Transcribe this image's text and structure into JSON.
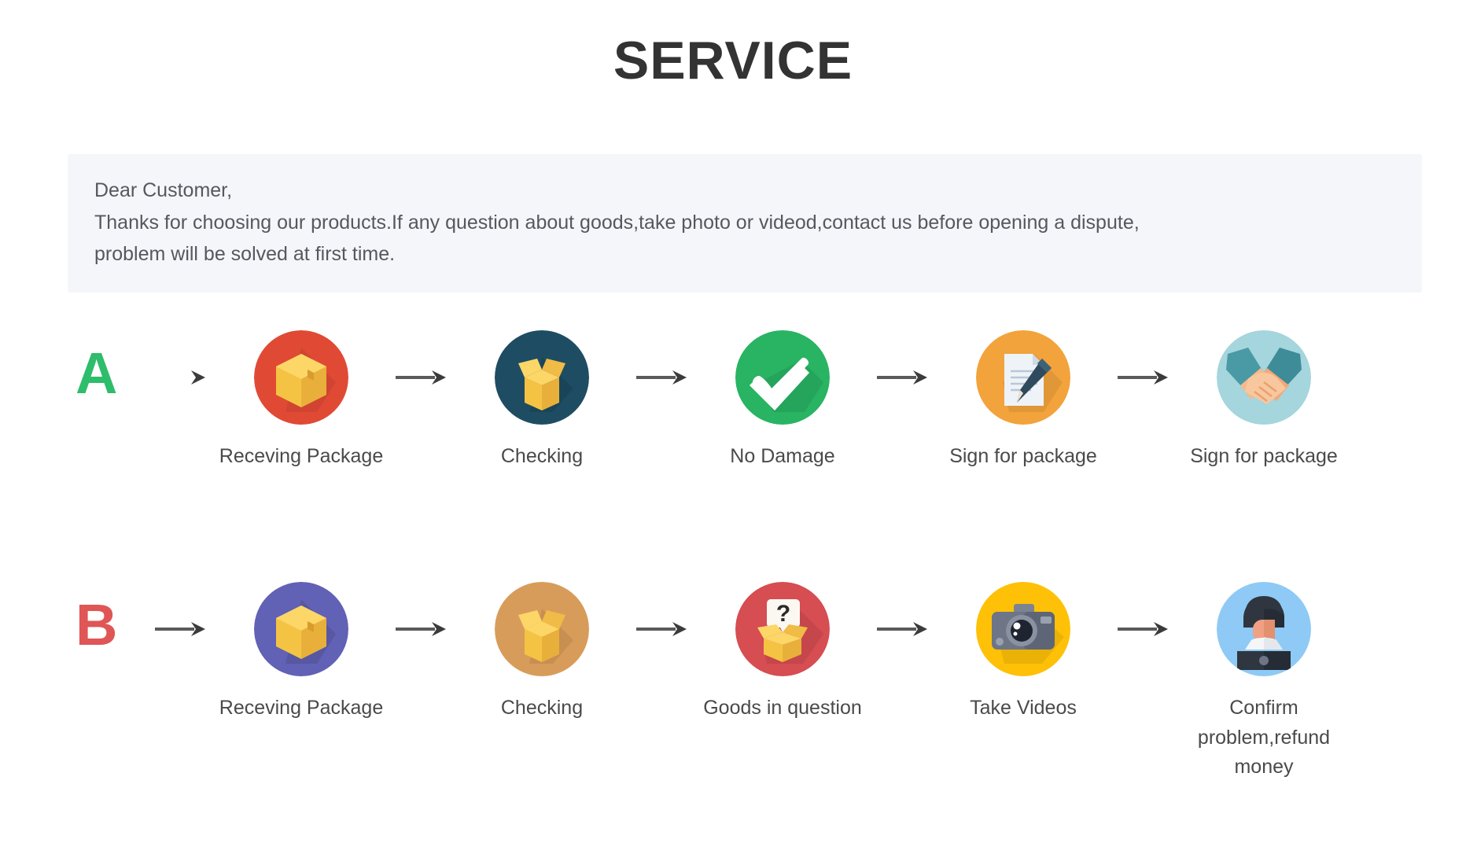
{
  "page": {
    "title": "SERVICE",
    "background": "#ffffff"
  },
  "notice": {
    "background": "#f4f6fa",
    "lines": [
      "Dear Customer,",
      "Thanks for choosing our products.If any question about goods,take photo or videod,contact us before opening a dispute,",
      "problem will be solved at first time."
    ]
  },
  "flows": [
    {
      "letter": "A",
      "letter_color": "#2ebd6b",
      "steps": [
        {
          "label": "Receving Package",
          "icon": "package-box-icon",
          "circle_color": "#e04a35"
        },
        {
          "label": "Checking",
          "icon": "open-box-icon",
          "circle_color": "#1e4d63"
        },
        {
          "label": "No Damage",
          "icon": "check-mark-icon",
          "circle_color": "#28b463"
        },
        {
          "label": "Sign for package",
          "icon": "document-pen-icon",
          "circle_color": "#f2a33c"
        },
        {
          "label": "Sign for package",
          "icon": "handshake-icon",
          "circle_color": "#a5d5dd"
        }
      ]
    },
    {
      "letter": "B",
      "letter_color": "#e05555",
      "steps": [
        {
          "label": "Receving Package",
          "icon": "package-box-icon",
          "circle_color": "#6161b5"
        },
        {
          "label": "Checking",
          "icon": "open-box-icon",
          "circle_color": "#d89c5a"
        },
        {
          "label": "Goods in question",
          "icon": "question-box-icon",
          "circle_color": "#d64d52"
        },
        {
          "label": "Take Videos",
          "icon": "camera-icon",
          "circle_color": "#fec107"
        },
        {
          "label": "Confirm problem,refund money",
          "icon": "support-person-icon",
          "circle_color": "#8ecaf5"
        }
      ]
    }
  ],
  "arrow": {
    "icon": "arrow-right-icon",
    "color": "#4a4a4a"
  }
}
